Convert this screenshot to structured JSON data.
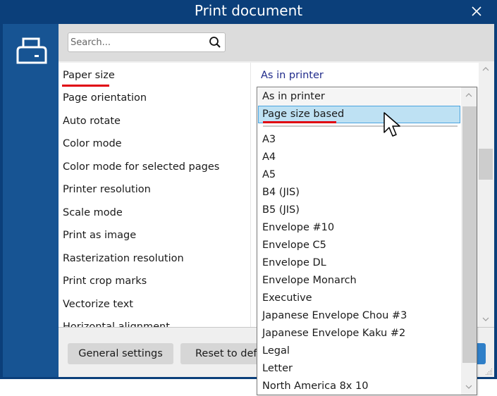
{
  "window": {
    "title": "Print document"
  },
  "search": {
    "placeholder": "Search..."
  },
  "properties": [
    {
      "label": "Paper size",
      "value": "As in printer"
    },
    {
      "label": "Page orientation"
    },
    {
      "label": "Auto rotate"
    },
    {
      "label": "Color mode"
    },
    {
      "label": "Color mode for selected pages"
    },
    {
      "label": "Printer resolution"
    },
    {
      "label": "Scale mode"
    },
    {
      "label": "Print as image"
    },
    {
      "label": "Rasterization resolution"
    },
    {
      "label": "Print crop marks"
    },
    {
      "label": "Vectorize text"
    },
    {
      "label": "Horizontal alignment"
    }
  ],
  "footer": {
    "general_settings": "General settings",
    "reset_defaults": "Reset to defa"
  },
  "dropdown": {
    "selected": "As in printer",
    "hovered": "Page size based",
    "options": [
      "As in printer",
      "Page size based",
      "A3",
      "A4",
      "A5",
      "B4 (JIS)",
      "B5 (JIS)",
      "Envelope #10",
      "Envelope C5",
      "Envelope DL",
      "Envelope Monarch",
      "Executive",
      "Japanese Envelope Chou #3",
      "Japanese Envelope Kaku #2",
      "Legal",
      "Letter",
      "North America 8x 10"
    ]
  },
  "colors": {
    "titlebar": "#0b3f7a",
    "sidebar": "#175493",
    "value_text": "#1f2a8a",
    "highlight": "#bee1f3",
    "annotation_red": "#e0000f"
  }
}
